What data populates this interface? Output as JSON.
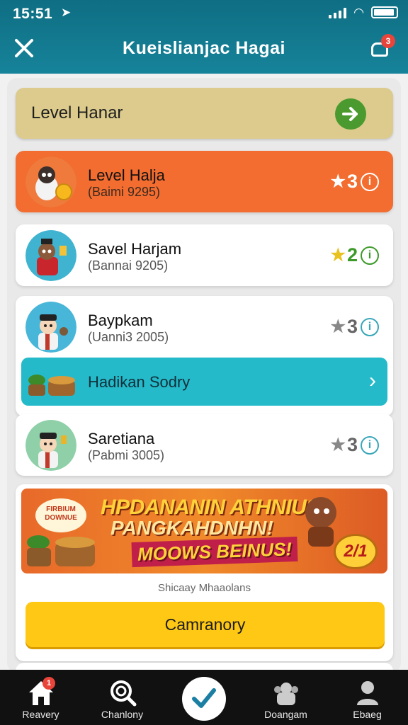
{
  "status_bar": {
    "time": "15:51"
  },
  "header": {
    "title": "Kueislianjac Hagai",
    "notification_count": "3"
  },
  "level_banner": {
    "label": "Level Hanar"
  },
  "cards": [
    {
      "name": "Level Halja",
      "sub": "(Baimi 9295)",
      "score": "3",
      "style": "orange",
      "star_color": "#ffffff"
    },
    {
      "name": "Savel Harjam",
      "sub": "(Bannai 9205)",
      "score": "2",
      "style": "white",
      "star_color": "#e8c21e"
    },
    {
      "name": "Baypkam",
      "sub": "(Uanni3 2005)",
      "score": "3",
      "style": "white",
      "star_color": "#888888"
    },
    {
      "name": "Saretiana",
      "sub": "(Pabmi 3005)",
      "score": "3",
      "style": "white",
      "star_color": "#888888"
    }
  ],
  "teal_bar": {
    "label": "Hadikan Sodry"
  },
  "promo": {
    "sticker": "FIRBIUM DOWNUE",
    "line1": "HPDANANIN ATHNIUS",
    "line2": "PANGKAHDNHN!",
    "line3": "MOOWS BEINUS!",
    "badge": "2/1",
    "caption": "Shicaay Mhaaolans",
    "button": "Camranory"
  },
  "tabbar": {
    "items": [
      {
        "label": "Reavery",
        "icon": "home-icon",
        "badge": "1"
      },
      {
        "label": "Chanlony",
        "icon": "search-icon"
      },
      {
        "label": "",
        "icon": "check-icon"
      },
      {
        "label": "Doangam",
        "icon": "group-icon"
      },
      {
        "label": "Ebaeg",
        "icon": "profile-icon"
      }
    ]
  },
  "colors": {
    "header": "#16839a",
    "orange_card": "#f26d2f",
    "teal_bar": "#25bac9",
    "button_yellow": "#ffc814",
    "arrow_green": "#4a9a2f"
  }
}
